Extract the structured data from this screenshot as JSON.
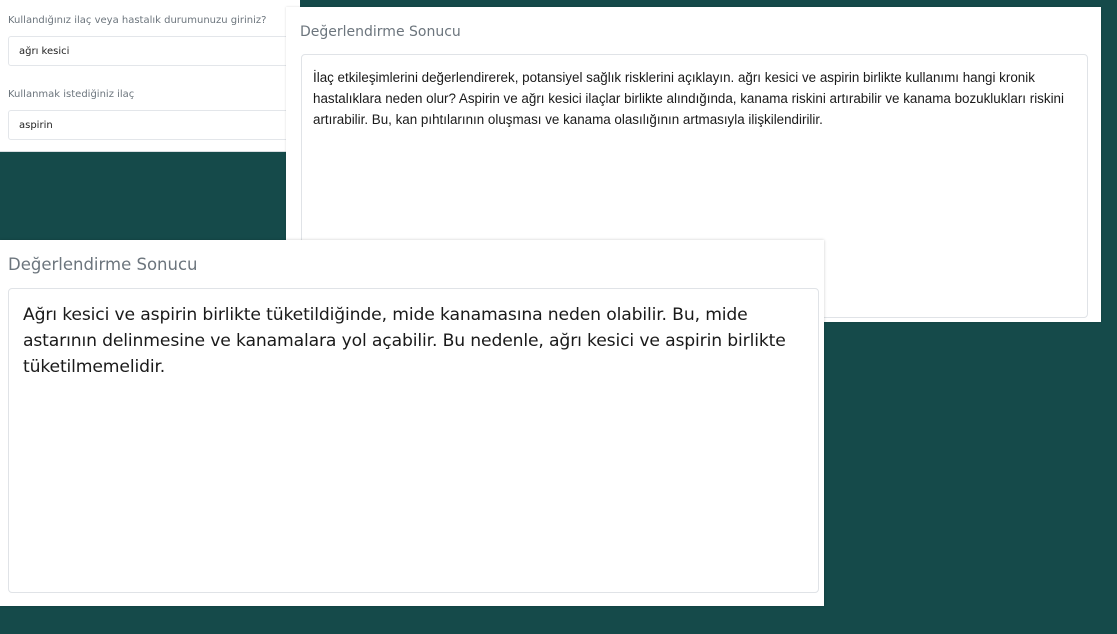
{
  "form": {
    "current_label": "Kullandığınız ilaç veya hastalık durumunuzu giriniz?",
    "current_value": "ağrı kesici",
    "wanted_label": "Kullanmak istediğiniz ilaç",
    "wanted_value": "aspirin"
  },
  "result_top": {
    "title": "Değerlendirme Sonucu",
    "text": "İlaç etkileşimlerini değerlendirerek, potansiyel sağlık risklerini açıklayın. ağrı kesici ve aspirin birlikte kullanımı hangi kronik hastalıklara neden olur? Aspirin ve ağrı kesici ilaçlar birlikte alındığında, kanama riskini artırabilir ve kanama bozuklukları riskini artırabilir. Bu, kan pıhtılarının oluşması ve kanama olasılığının artmasıyla ilişkilendirilir."
  },
  "result_bottom": {
    "title": "Değerlendirme Sonucu",
    "text": "Ağrı kesici ve aspirin birlikte tüketildiğinde, mide kanamasına neden olabilir. Bu, mide astarının delinmesine ve kanamalara yol açabilir. Bu nedenle, ağrı kesici ve aspirin birlikte tüketilmemelidir."
  },
  "colors": {
    "background": "#154a4a",
    "panel": "#ffffff",
    "muted_text": "#6c757d"
  }
}
